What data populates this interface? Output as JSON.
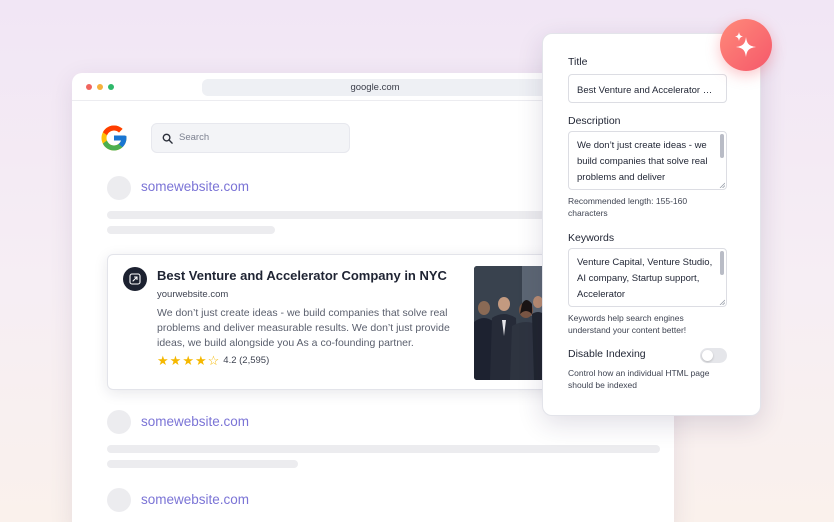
{
  "browser": {
    "url": "google.com",
    "window_dots": [
      "#f0655e",
      "#f6b13c",
      "#2fb86a"
    ],
    "search_placeholder": "Search"
  },
  "results": {
    "placeholder_site": "somewebsite.com",
    "featured": {
      "title": "Best Venture and Accelerator Company in NYC",
      "url": "yourwebsite.com",
      "description": "We don’t just create ideas - we build companies that solve real problems and deliver measurable results. We don’t just provide ideas, we build alongside you As a co-founding partner.",
      "rating_text": "4.2 (2,595)",
      "stars_filled": 4,
      "stars_total": 5,
      "favicon": "external-link-icon",
      "image": "business-team-photo"
    }
  },
  "seo_panel": {
    "title_label": "Title",
    "title_value": "Best Venture and Accelerator Company in NYC",
    "description_label": "Description",
    "description_value": "We don’t just create ideas - we build companies that solve real problems and deliver measurable results.",
    "description_hint": "Recommended length: 155-160 characters",
    "keywords_label": "Keywords",
    "keywords_value": "Venture Capital, Venture Studio, AI company, Startup support, Accelerator",
    "keywords_hint": "Keywords help search engines understand your content better!",
    "indexing_label": "Disable Indexing",
    "indexing_enabled": false,
    "indexing_hint": "Control how an individual HTML page should be indexed"
  },
  "colors": {
    "accent_link": "#7b74d6",
    "star": "#f5b800",
    "magic_button": "#f5586a"
  },
  "icons": {
    "magic": "sparkles-icon",
    "search": "search-icon",
    "logo": "google-logo"
  }
}
